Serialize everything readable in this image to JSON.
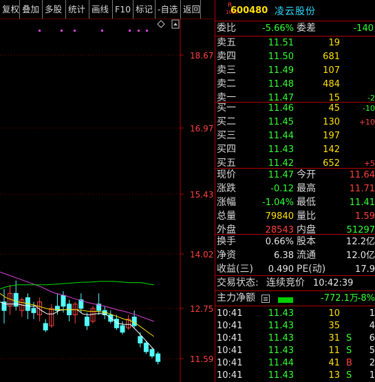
{
  "toolbar": [
    {
      "label": "复权",
      "name": "fuquan-button"
    },
    {
      "label": "叠加",
      "name": "overlay-button"
    },
    {
      "label": "多股",
      "name": "multi-stock-button"
    },
    {
      "label": "统计",
      "name": "statistics-button"
    },
    {
      "label": "画线",
      "name": "draw-line-button"
    },
    {
      "label": "F10",
      "name": "f10-button"
    },
    {
      "label": "标记",
      "name": "mark-button"
    },
    {
      "label": "-自选",
      "name": "remove-watchlist-button"
    },
    {
      "label": "返回",
      "name": "back-button"
    }
  ],
  "chart": {
    "price_labels": [
      "18.67",
      "16.97",
      "15.43",
      "14.02",
      "12.75",
      "11.59"
    ],
    "diamond_icon": "diamond-icon",
    "scroll_icon": "scroll-up-icon"
  },
  "chart_data": {
    "type": "candlestick",
    "y_axis_ticks": [
      18.67,
      16.97,
      15.43,
      14.02,
      12.75,
      11.59
    ],
    "candles": [
      {
        "o": 12.9,
        "c": 12.7,
        "h": 13.2,
        "l": 12.4
      },
      {
        "o": 12.8,
        "c": 13.1,
        "h": 13.3,
        "l": 12.6
      },
      {
        "o": 13.1,
        "c": 12.8,
        "h": 13.4,
        "l": 12.7
      },
      {
        "o": 12.7,
        "c": 12.95,
        "h": 13.0,
        "l": 12.55
      },
      {
        "o": 13.0,
        "c": 12.7,
        "h": 13.1,
        "l": 12.5
      },
      {
        "o": 12.75,
        "c": 12.65,
        "h": 12.9,
        "l": 12.5
      },
      {
        "o": 12.6,
        "c": 12.9,
        "h": 13.0,
        "l": 12.45
      },
      {
        "o": 12.4,
        "c": 12.25,
        "h": 12.5,
        "l": 12.2
      },
      {
        "o": 12.35,
        "c": 12.75,
        "h": 12.85,
        "l": 12.3
      },
      {
        "o": 12.8,
        "c": 12.7,
        "h": 13.1,
        "l": 12.6
      },
      {
        "o": 13.05,
        "c": 12.8,
        "h": 13.15,
        "l": 12.65
      },
      {
        "o": 12.85,
        "c": 12.6,
        "h": 12.95,
        "l": 12.45
      },
      {
        "o": 12.6,
        "c": 12.85,
        "h": 12.9,
        "l": 12.4
      },
      {
        "o": 12.95,
        "c": 12.75,
        "h": 13.1,
        "l": 12.65
      },
      {
        "o": 12.55,
        "c": 12.35,
        "h": 12.65,
        "l": 12.25
      },
      {
        "o": 12.45,
        "c": 12.75,
        "h": 12.8,
        "l": 12.4
      },
      {
        "o": 12.85,
        "c": 12.7,
        "h": 13.1,
        "l": 12.6
      },
      {
        "o": 12.7,
        "c": 12.6,
        "h": 12.8,
        "l": 12.5
      },
      {
        "o": 12.6,
        "c": 12.45,
        "h": 12.7,
        "l": 12.4
      },
      {
        "o": 12.5,
        "c": 12.3,
        "h": 12.6,
        "l": 12.25
      },
      {
        "o": 12.35,
        "c": 12.2,
        "h": 12.45,
        "l": 12.15
      },
      {
        "o": 12.3,
        "c": 12.5,
        "h": 12.6,
        "l": 12.25
      },
      {
        "o": 12.55,
        "c": 12.35,
        "h": 12.7,
        "l": 12.3
      },
      {
        "o": 12.1,
        "c": 11.95,
        "h": 12.2,
        "l": 11.85
      },
      {
        "o": 11.95,
        "c": 11.75,
        "h": 12.0,
        "l": 11.7
      },
      {
        "o": 11.8,
        "c": 11.65,
        "h": 11.85,
        "l": 11.6
      },
      {
        "o": 11.7,
        "c": 11.52,
        "h": 11.75,
        "l": 11.45
      }
    ],
    "ma_series": [
      {
        "color": "#ffffff",
        "values": [
          12.9,
          12.85,
          12.85,
          12.85,
          12.82,
          12.8,
          12.8,
          12.7,
          12.62,
          12.62,
          12.7,
          12.72,
          12.72,
          12.72,
          12.62,
          12.6,
          12.62,
          12.63,
          12.6,
          12.5,
          12.4,
          12.38,
          12.38,
          12.25,
          12.1,
          11.95,
          11.8
        ]
      },
      {
        "color": "#ffe000",
        "values": [
          13.1,
          13.0,
          12.95,
          12.9,
          12.88,
          12.85,
          12.82,
          12.78,
          12.74,
          12.72,
          12.72,
          12.72,
          12.72,
          12.72,
          12.7,
          12.68,
          12.68,
          12.67,
          12.65,
          12.6,
          12.55,
          12.5,
          12.47,
          12.4,
          12.3,
          12.2,
          12.1
        ]
      },
      {
        "color": "#e040e0",
        "values": [
          13.6,
          13.55,
          13.5,
          13.45,
          13.4,
          13.35,
          13.3,
          13.25,
          13.18,
          13.12,
          13.08,
          13.05,
          13.0,
          12.96,
          12.92,
          12.88,
          12.85,
          12.82,
          12.79,
          12.75,
          12.71,
          12.68,
          12.64,
          12.6,
          12.55,
          12.5,
          12.45
        ]
      },
      {
        "color": "#00e000",
        "values": [
          13.2,
          13.25,
          13.28,
          13.3,
          13.3,
          13.3,
          13.3,
          13.3,
          13.3,
          13.31,
          13.32,
          13.33,
          13.34,
          13.35,
          13.36,
          13.36,
          13.37,
          13.38,
          13.38,
          13.38,
          13.37,
          13.36,
          13.35,
          13.35,
          13.35,
          13.32,
          13.3
        ]
      }
    ]
  },
  "stock": {
    "code": "600480",
    "name": "凌云股份",
    "badge_top": "R",
    "badge_bottom": "1000"
  },
  "weibi": {
    "label": "委比",
    "value": "-5.66%",
    "label2": "委差",
    "value2": "-140"
  },
  "asks": [
    {
      "label": "卖五",
      "price": "11.51",
      "vol": "19",
      "chg": ""
    },
    {
      "label": "卖四",
      "price": "11.50",
      "vol": "681",
      "chg": ""
    },
    {
      "label": "卖三",
      "price": "11.49",
      "vol": "107",
      "chg": ""
    },
    {
      "label": "卖二",
      "price": "11.48",
      "vol": "484",
      "chg": ""
    },
    {
      "label": "卖一",
      "price": "11.47",
      "vol": "15",
      "chg": "-2"
    }
  ],
  "bids": [
    {
      "label": "买一",
      "price": "11.46",
      "vol": "45",
      "chg": "-10"
    },
    {
      "label": "买二",
      "price": "11.45",
      "vol": "130",
      "chg": "+10"
    },
    {
      "label": "买三",
      "price": "11.44",
      "vol": "197",
      "chg": ""
    },
    {
      "label": "买四",
      "price": "11.43",
      "vol": "142",
      "chg": ""
    },
    {
      "label": "买五",
      "price": "11.42",
      "vol": "652",
      "chg": "+5"
    }
  ],
  "quote": [
    {
      "l1": "现价",
      "v1": "11.47",
      "c1": "grn",
      "l2": "今开",
      "v2": "11.64",
      "c2": "red"
    },
    {
      "l1": "涨跌",
      "v1": "-0.12",
      "c1": "grn",
      "l2": "最高",
      "v2": "11.71",
      "c2": "red"
    },
    {
      "l1": "涨幅",
      "v1": "-1.04%",
      "c1": "grn",
      "l2": "最低",
      "v2": "11.41",
      "c2": "grn"
    },
    {
      "l1": "总量",
      "v1": "79840",
      "c1": "yel",
      "l2": "量比",
      "v2": "1.59",
      "c2": "red"
    },
    {
      "l1": "外盘",
      "v1": "28543",
      "c1": "red",
      "l2": "内盘",
      "v2": "51297",
      "c2": "grn"
    }
  ],
  "stats": [
    {
      "l1": "换手",
      "v1": "0.66%",
      "l2": "股本",
      "v2": "12.2亿"
    },
    {
      "l1": "净资",
      "v1": "6.38",
      "l2": "流通",
      "v2": "12.0亿"
    },
    {
      "l1": "收益(三)",
      "v1": "0.490",
      "l2": "PE(动)",
      "v2": "17.9"
    }
  ],
  "status": {
    "label": "交易状态:",
    "value": "连续竞价",
    "time": "10:42:39"
  },
  "flow": {
    "label": "主力净额",
    "icon": "list-icon",
    "amount": "-772.1万",
    "pct": "-8%"
  },
  "ticks": [
    {
      "time": "10:41",
      "price": "11.43",
      "vol": "10",
      "flag": "",
      "n": "1"
    },
    {
      "time": "10:41",
      "price": "11.43",
      "vol": "35",
      "flag": "",
      "n": "4"
    },
    {
      "time": "10:41",
      "price": "11.43",
      "vol": "31",
      "flag": "S",
      "n": "6"
    },
    {
      "time": "10:41",
      "price": "11.43",
      "vol": "11",
      "flag": "S",
      "n": "5"
    },
    {
      "time": "10:41",
      "price": "11.44",
      "vol": "41",
      "flag": "B",
      "n": "2"
    },
    {
      "time": "10:41",
      "price": "11.43",
      "vol": "13",
      "flag": "S",
      "n": "1"
    }
  ],
  "colors": {
    "up": "#ff4040",
    "down": "#33ff33",
    "grid": "#b40000",
    "accent": "#ffe000",
    "cyan": "#2fd8ff"
  }
}
